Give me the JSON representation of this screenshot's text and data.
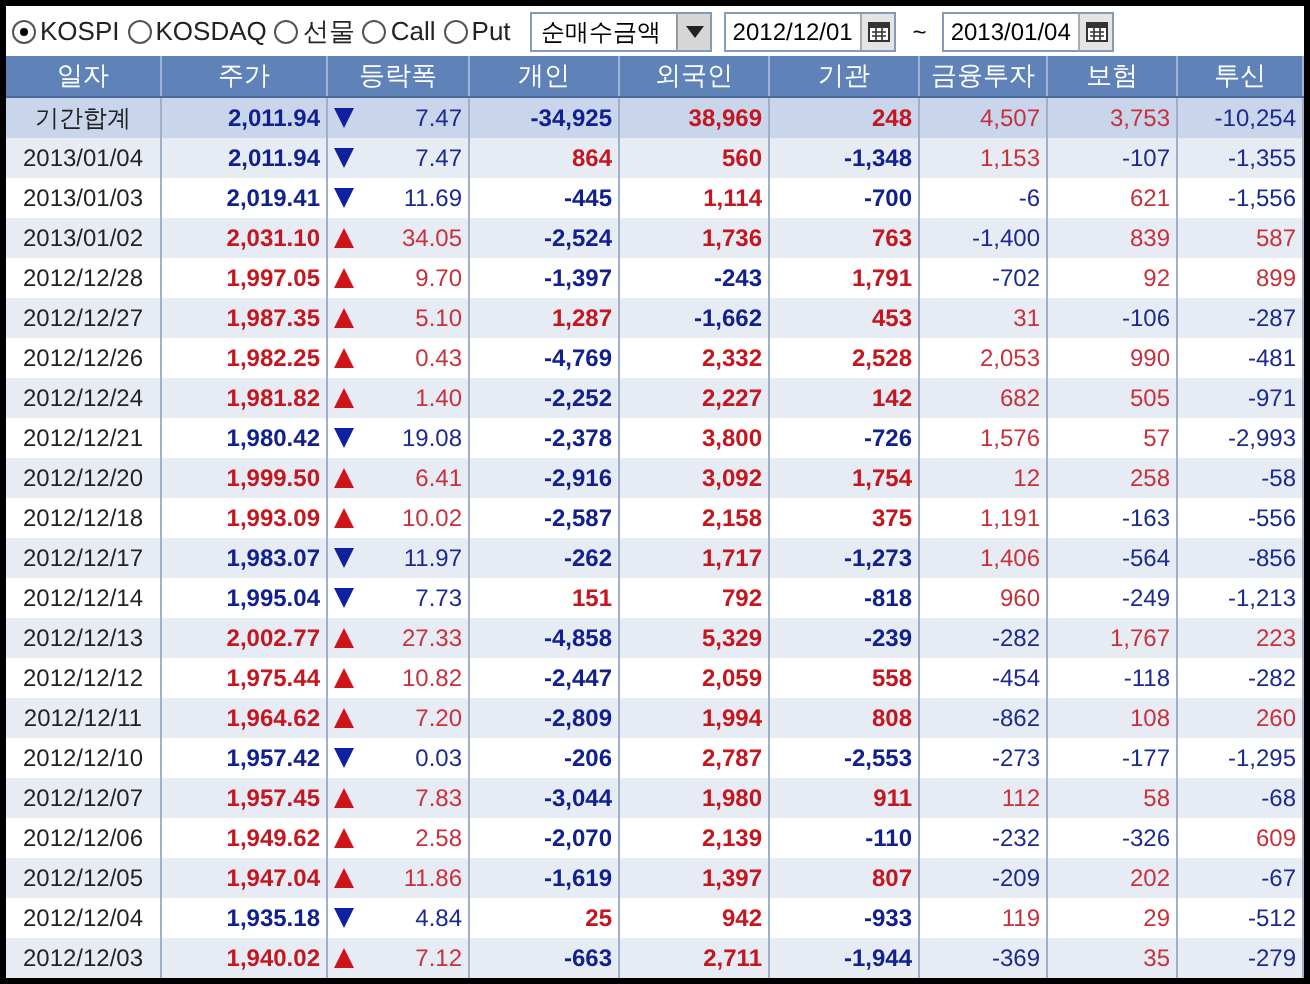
{
  "filters": [
    {
      "label": "KOSPI",
      "selected": true
    },
    {
      "label": "KOSDAQ",
      "selected": false
    },
    {
      "label": "선물",
      "selected": false
    },
    {
      "label": "Call",
      "selected": false
    },
    {
      "label": "Put",
      "selected": false
    }
  ],
  "measure": {
    "value": "순매수금액"
  },
  "date_from": {
    "value": "2012/12/01"
  },
  "separator": "~",
  "date_to": {
    "value": "2013/01/04"
  },
  "table": {
    "columns": [
      "일자",
      "주가",
      "등락폭",
      "개인",
      "외국인",
      "기관",
      "금융투자",
      "보험",
      "투신"
    ],
    "rows": [
      {
        "summary": true,
        "date": "기간합계",
        "price": "2,011.94",
        "rising": false,
        "change": "7.47",
        "individual": "-34,925",
        "foreign": "38,969",
        "institution": "248",
        "financial_investment": "4,507",
        "insurance": "3,753",
        "investment_trust": "-10,254"
      },
      {
        "summary": false,
        "date": "2013/01/04",
        "price": "2,011.94",
        "rising": false,
        "change": "7.47",
        "individual": "864",
        "foreign": "560",
        "institution": "-1,348",
        "financial_investment": "1,153",
        "insurance": "-107",
        "investment_trust": "-1,355"
      },
      {
        "summary": false,
        "date": "2013/01/03",
        "price": "2,019.41",
        "rising": false,
        "change": "11.69",
        "individual": "-445",
        "foreign": "1,114",
        "institution": "-700",
        "financial_investment": "-6",
        "insurance": "621",
        "investment_trust": "-1,556"
      },
      {
        "summary": false,
        "date": "2013/01/02",
        "price": "2,031.10",
        "rising": true,
        "change": "34.05",
        "individual": "-2,524",
        "foreign": "1,736",
        "institution": "763",
        "financial_investment": "-1,400",
        "insurance": "839",
        "investment_trust": "587"
      },
      {
        "summary": false,
        "date": "2012/12/28",
        "price": "1,997.05",
        "rising": true,
        "change": "9.70",
        "individual": "-1,397",
        "foreign": "-243",
        "institution": "1,791",
        "financial_investment": "-702",
        "insurance": "92",
        "investment_trust": "899"
      },
      {
        "summary": false,
        "date": "2012/12/27",
        "price": "1,987.35",
        "rising": true,
        "change": "5.10",
        "individual": "1,287",
        "foreign": "-1,662",
        "institution": "453",
        "financial_investment": "31",
        "insurance": "-106",
        "investment_trust": "-287"
      },
      {
        "summary": false,
        "date": "2012/12/26",
        "price": "1,982.25",
        "rising": true,
        "change": "0.43",
        "individual": "-4,769",
        "foreign": "2,332",
        "institution": "2,528",
        "financial_investment": "2,053",
        "insurance": "990",
        "investment_trust": "-481"
      },
      {
        "summary": false,
        "date": "2012/12/24",
        "price": "1,981.82",
        "rising": true,
        "change": "1.40",
        "individual": "-2,252",
        "foreign": "2,227",
        "institution": "142",
        "financial_investment": "682",
        "insurance": "505",
        "investment_trust": "-971"
      },
      {
        "summary": false,
        "date": "2012/12/21",
        "price": "1,980.42",
        "rising": false,
        "change": "19.08",
        "individual": "-2,378",
        "foreign": "3,800",
        "institution": "-726",
        "financial_investment": "1,576",
        "insurance": "57",
        "investment_trust": "-2,993"
      },
      {
        "summary": false,
        "date": "2012/12/20",
        "price": "1,999.50",
        "rising": true,
        "change": "6.41",
        "individual": "-2,916",
        "foreign": "3,092",
        "institution": "1,754",
        "financial_investment": "12",
        "insurance": "258",
        "investment_trust": "-58"
      },
      {
        "summary": false,
        "date": "2012/12/18",
        "price": "1,993.09",
        "rising": true,
        "change": "10.02",
        "individual": "-2,587",
        "foreign": "2,158",
        "institution": "375",
        "financial_investment": "1,191",
        "insurance": "-163",
        "investment_trust": "-556"
      },
      {
        "summary": false,
        "date": "2012/12/17",
        "price": "1,983.07",
        "rising": false,
        "change": "11.97",
        "individual": "-262",
        "foreign": "1,717",
        "institution": "-1,273",
        "financial_investment": "1,406",
        "insurance": "-564",
        "investment_trust": "-856"
      },
      {
        "summary": false,
        "date": "2012/12/14",
        "price": "1,995.04",
        "rising": false,
        "change": "7.73",
        "individual": "151",
        "foreign": "792",
        "institution": "-818",
        "financial_investment": "960",
        "insurance": "-249",
        "investment_trust": "-1,213"
      },
      {
        "summary": false,
        "date": "2012/12/13",
        "price": "2,002.77",
        "rising": true,
        "change": "27.33",
        "individual": "-4,858",
        "foreign": "5,329",
        "institution": "-239",
        "financial_investment": "-282",
        "insurance": "1,767",
        "investment_trust": "223"
      },
      {
        "summary": false,
        "date": "2012/12/12",
        "price": "1,975.44",
        "rising": true,
        "change": "10.82",
        "individual": "-2,447",
        "foreign": "2,059",
        "institution": "558",
        "financial_investment": "-454",
        "insurance": "-118",
        "investment_trust": "-282"
      },
      {
        "summary": false,
        "date": "2012/12/11",
        "price": "1,964.62",
        "rising": true,
        "change": "7.20",
        "individual": "-2,809",
        "foreign": "1,994",
        "institution": "808",
        "financial_investment": "-862",
        "insurance": "108",
        "investment_trust": "260"
      },
      {
        "summary": false,
        "date": "2012/12/10",
        "price": "1,957.42",
        "rising": false,
        "change": "0.03",
        "individual": "-206",
        "foreign": "2,787",
        "institution": "-2,553",
        "financial_investment": "-273",
        "insurance": "-177",
        "investment_trust": "-1,295"
      },
      {
        "summary": false,
        "date": "2012/12/07",
        "price": "1,957.45",
        "rising": true,
        "change": "7.83",
        "individual": "-3,044",
        "foreign": "1,980",
        "institution": "911",
        "financial_investment": "112",
        "insurance": "58",
        "investment_trust": "-68"
      },
      {
        "summary": false,
        "date": "2012/12/06",
        "price": "1,949.62",
        "rising": true,
        "change": "2.58",
        "individual": "-2,070",
        "foreign": "2,139",
        "institution": "-110",
        "financial_investment": "-232",
        "insurance": "-326",
        "investment_trust": "609"
      },
      {
        "summary": false,
        "date": "2012/12/05",
        "price": "1,947.04",
        "rising": true,
        "change": "11.86",
        "individual": "-1,619",
        "foreign": "1,397",
        "institution": "807",
        "financial_investment": "-209",
        "insurance": "202",
        "investment_trust": "-67"
      },
      {
        "summary": false,
        "date": "2012/12/04",
        "price": "1,935.18",
        "rising": false,
        "change": "4.84",
        "individual": "25",
        "foreign": "942",
        "institution": "-933",
        "financial_investment": "119",
        "insurance": "29",
        "investment_trust": "-512"
      },
      {
        "summary": false,
        "date": "2012/12/03",
        "price": "1,940.02",
        "rising": true,
        "change": "7.12",
        "individual": "-663",
        "foreign": "2,711",
        "institution": "-1,944",
        "financial_investment": "-369",
        "insurance": "35",
        "investment_trust": "-279"
      }
    ]
  }
}
